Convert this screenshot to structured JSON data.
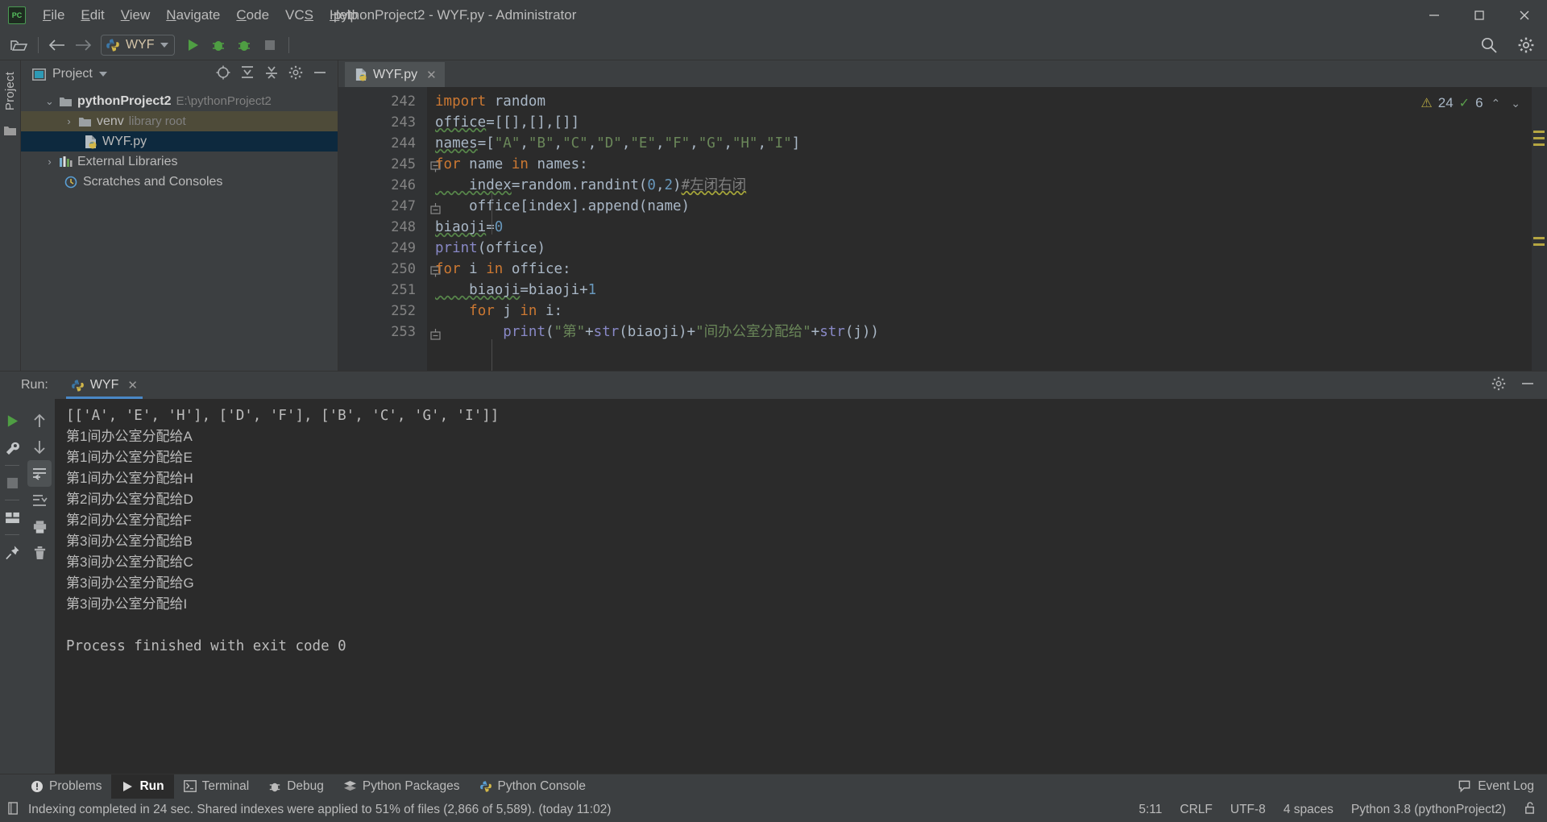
{
  "window": {
    "title": "pythonProject2 - WYF.py - Administrator",
    "app_icon": "pycharm-logo-icon",
    "minimize": "minimize-icon",
    "maximize": "maximize-icon",
    "close": "close-icon"
  },
  "menu": {
    "items": [
      {
        "label": "File",
        "mnemonic": "F"
      },
      {
        "label": "Edit",
        "mnemonic": "E"
      },
      {
        "label": "View",
        "mnemonic": "V"
      },
      {
        "label": "Navigate",
        "mnemonic": "N"
      },
      {
        "label": "Code",
        "mnemonic": "C"
      },
      {
        "label": "VCS",
        "mnemonic": "S"
      },
      {
        "label": "Help",
        "mnemonic": "H"
      }
    ]
  },
  "toolbar": {
    "open_label": "open-folder-icon",
    "back_label": "back-arrow-icon",
    "forward_label": "forward-arrow-icon",
    "run_config_name": "WYF",
    "run_label": "run-icon",
    "debug_label": "debug-icon",
    "coverage_label": "coverage-icon",
    "stop_label": "stop-icon",
    "search_label": "search-icon",
    "settings_label": "settings-gear-icon"
  },
  "sidebar": {
    "vertical_tab": "Project",
    "panel_title": "Project",
    "tree": [
      {
        "label": "pythonProject2",
        "sublabel": "E:\\pythonProject2",
        "icon": "folder-icon",
        "level": 1,
        "expanded": true,
        "state": "normal"
      },
      {
        "label": "venv",
        "sublabel": "library root",
        "icon": "folder-icon",
        "level": 2,
        "expanded": false,
        "state": "hover"
      },
      {
        "label": "WYF.py",
        "sublabel": "",
        "icon": "python-file-icon",
        "level": 3,
        "expanded": null,
        "state": "selected"
      },
      {
        "label": "External Libraries",
        "sublabel": "",
        "icon": "libraries-icon",
        "level": 1,
        "expanded": false,
        "state": "normal"
      },
      {
        "label": "Scratches and Consoles",
        "sublabel": "",
        "icon": "scratches-icon",
        "level": 1,
        "expanded": null,
        "state": "normal"
      }
    ]
  },
  "editor": {
    "tab_name": "WYF.py",
    "tab_icon": "python-file-icon",
    "tab_close": "close-icon",
    "warnings_count": "24",
    "checks_count": "6",
    "lines": [
      {
        "num": "242",
        "fold": "",
        "tokens": [
          {
            "t": "import ",
            "c": "kw"
          },
          {
            "t": "random",
            "c": "pl"
          }
        ]
      },
      {
        "num": "243",
        "fold": "",
        "tokens": [
          {
            "t": "office",
            "c": "pl wavy-g"
          },
          {
            "t": "=[[],[],[]]",
            "c": "pl"
          }
        ]
      },
      {
        "num": "244",
        "fold": "",
        "tokens": [
          {
            "t": "names",
            "c": "pl wavy-g"
          },
          {
            "t": "=[",
            "c": "pl"
          },
          {
            "t": "\"A\"",
            "c": "str"
          },
          {
            "t": ",",
            "c": "pl"
          },
          {
            "t": "\"B\"",
            "c": "str"
          },
          {
            "t": ",",
            "c": "pl"
          },
          {
            "t": "\"C\"",
            "c": "str"
          },
          {
            "t": ",",
            "c": "pl"
          },
          {
            "t": "\"D\"",
            "c": "str"
          },
          {
            "t": ",",
            "c": "pl"
          },
          {
            "t": "\"E\"",
            "c": "str"
          },
          {
            "t": ",",
            "c": "pl"
          },
          {
            "t": "\"F\"",
            "c": "str"
          },
          {
            "t": ",",
            "c": "pl"
          },
          {
            "t": "\"G\"",
            "c": "str"
          },
          {
            "t": ",",
            "c": "pl"
          },
          {
            "t": "\"H\"",
            "c": "str"
          },
          {
            "t": ",",
            "c": "pl"
          },
          {
            "t": "\"I\"",
            "c": "str"
          },
          {
            "t": "]",
            "c": "pl"
          }
        ]
      },
      {
        "num": "245",
        "fold": "minus",
        "tokens": [
          {
            "t": "for ",
            "c": "kw"
          },
          {
            "t": "name ",
            "c": "pl"
          },
          {
            "t": "in ",
            "c": "kw"
          },
          {
            "t": "names:",
            "c": "pl"
          }
        ]
      },
      {
        "num": "246",
        "fold": "",
        "tokens": [
          {
            "t": "    index",
            "c": "pl wavy-g"
          },
          {
            "t": "=random.randint(",
            "c": "pl"
          },
          {
            "t": "0",
            "c": "num"
          },
          {
            "t": ",",
            "c": "pl"
          },
          {
            "t": "2",
            "c": "num"
          },
          {
            "t": ")",
            "c": "pl"
          },
          {
            "t": "#左闭右闭",
            "c": "com wavy-y"
          }
        ]
      },
      {
        "num": "247",
        "fold": "end",
        "tokens": [
          {
            "t": "    office[index].append(name)",
            "c": "pl"
          }
        ]
      },
      {
        "num": "248",
        "fold": "",
        "tokens": [
          {
            "t": "biaoji",
            "c": "pl wavy-g"
          },
          {
            "t": "=",
            "c": "pl"
          },
          {
            "t": "0",
            "c": "num"
          }
        ]
      },
      {
        "num": "249",
        "fold": "",
        "tokens": [
          {
            "t": "print",
            "c": "fn"
          },
          {
            "t": "(office)",
            "c": "pl"
          }
        ]
      },
      {
        "num": "250",
        "fold": "minus",
        "tokens": [
          {
            "t": "for ",
            "c": "kw"
          },
          {
            "t": "i ",
            "c": "pl"
          },
          {
            "t": "in ",
            "c": "kw"
          },
          {
            "t": "office:",
            "c": "pl"
          }
        ]
      },
      {
        "num": "251",
        "fold": "",
        "tokens": [
          {
            "t": "    biaoji",
            "c": "pl wavy-g"
          },
          {
            "t": "=biaoji+",
            "c": "pl"
          },
          {
            "t": "1",
            "c": "num"
          }
        ]
      },
      {
        "num": "252",
        "fold": "",
        "tokens": [
          {
            "t": "    ",
            "c": "pl"
          },
          {
            "t": "for ",
            "c": "kw"
          },
          {
            "t": "j ",
            "c": "pl"
          },
          {
            "t": "in ",
            "c": "kw"
          },
          {
            "t": "i:",
            "c": "pl"
          }
        ]
      },
      {
        "num": "253",
        "fold": "end",
        "tokens": [
          {
            "t": "        ",
            "c": "pl"
          },
          {
            "t": "print",
            "c": "fn"
          },
          {
            "t": "(",
            "c": "pl"
          },
          {
            "t": "\"第\"",
            "c": "str"
          },
          {
            "t": "+",
            "c": "pl"
          },
          {
            "t": "str",
            "c": "fn"
          },
          {
            "t": "(biaoji)+",
            "c": "pl"
          },
          {
            "t": "\"间办公室分配给\"",
            "c": "str"
          },
          {
            "t": "+",
            "c": "pl"
          },
          {
            "t": "str",
            "c": "fn"
          },
          {
            "t": "(j))",
            "c": "pl"
          }
        ]
      }
    ]
  },
  "run_panel": {
    "label": "Run:",
    "tab_name": "WYF",
    "tab_icon": "python-icon",
    "tab_close": "close-icon",
    "settings_icon": "settings-gear-icon",
    "minimize_icon": "minimize-icon",
    "tools": [
      {
        "name": "rerun-icon"
      },
      {
        "name": "wrench-icon"
      },
      {
        "name": "stop-icon"
      },
      {
        "name": "layout-icon"
      },
      {
        "name": "pin-icon"
      }
    ],
    "tools2": [
      {
        "name": "scroll-up-icon"
      },
      {
        "name": "scroll-down-icon"
      },
      {
        "name": "soft-wrap-icon",
        "active": true
      },
      {
        "name": "scroll-to-end-icon"
      },
      {
        "name": "print-icon"
      },
      {
        "name": "trash-icon"
      }
    ],
    "console_lines": [
      {
        "text": "[['A', 'E', 'H'], ['D', 'F'], ['B', 'C', 'G', 'I']]",
        "mono": true
      },
      {
        "text": "第1间办公室分配给A",
        "mono": false
      },
      {
        "text": "第1间办公室分配给E",
        "mono": false
      },
      {
        "text": "第1间办公室分配给H",
        "mono": false
      },
      {
        "text": "第2间办公室分配给D",
        "mono": false
      },
      {
        "text": "第2间办公室分配给F",
        "mono": false
      },
      {
        "text": "第3间办公室分配给B",
        "mono": false
      },
      {
        "text": "第3间办公室分配给C",
        "mono": false
      },
      {
        "text": "第3间办公室分配给G",
        "mono": false
      },
      {
        "text": "第3间办公室分配给I",
        "mono": false
      },
      {
        "text": "",
        "mono": true
      },
      {
        "text": "Process finished with exit code 0",
        "mono": true
      }
    ]
  },
  "bottom_tabs": {
    "items": [
      {
        "label": "Problems",
        "icon": "problems-icon",
        "active": false
      },
      {
        "label": "Run",
        "icon": "run-icon",
        "active": true
      },
      {
        "label": "Terminal",
        "icon": "terminal-icon",
        "active": false
      },
      {
        "label": "Debug",
        "icon": "debug-icon",
        "active": false
      },
      {
        "label": "Python Packages",
        "icon": "packages-icon",
        "active": false
      },
      {
        "label": "Python Console",
        "icon": "python-console-icon",
        "active": false
      }
    ],
    "event_log": "Event Log",
    "event_log_icon": "event-log-icon"
  },
  "statusbar": {
    "message_icon": "indexing-icon",
    "message": "Indexing completed in 24 sec. Shared indexes were applied to 51% of files (2,866 of 5,589). (today 11:02)",
    "caret": "5:11",
    "line_sep": "CRLF",
    "encoding": "UTF-8",
    "indent": "4 spaces",
    "interpreter": "Python 3.8 (pythonProject2)",
    "lock_icon": "unlocked-icon"
  },
  "colors": {
    "bg_panel": "#3c3f41",
    "bg_editor": "#2b2b2b",
    "accent_blue": "#4a88c7",
    "selection": "#0d293e",
    "keyword": "#cc7832",
    "string": "#6a8759",
    "number": "#6897bb",
    "function": "#8888c6",
    "comment": "#808080"
  }
}
